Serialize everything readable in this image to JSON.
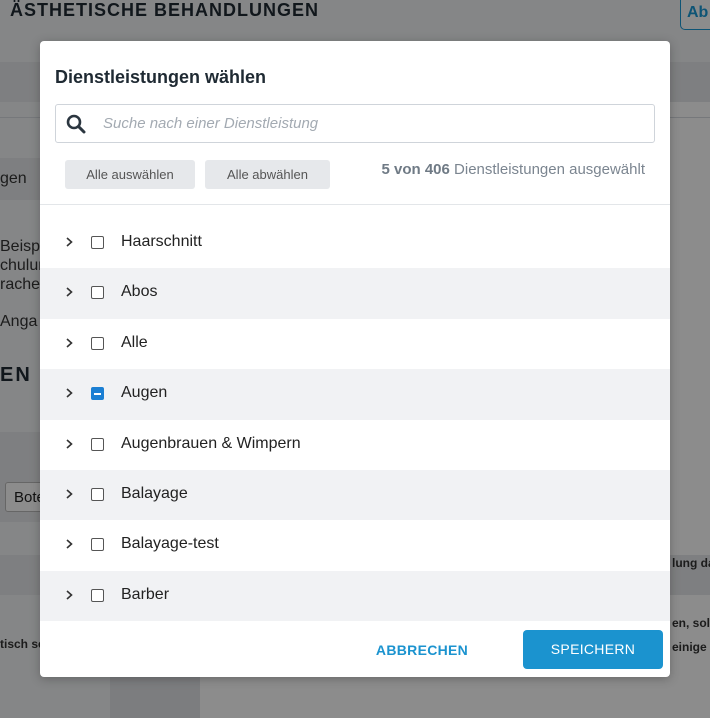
{
  "background": {
    "page_title": "ÄSTHETISCHE BEHANDLUNGEN",
    "header_button": "Ab",
    "fragments": [
      "gen",
      "Beisp",
      "chulun",
      "rache",
      "Anga",
      "EN",
      "Bote",
      "lung da",
      "en, sollt",
      "einige",
      "tisch se"
    ]
  },
  "modal": {
    "title": "Dienstleistungen wählen",
    "search_placeholder": "Suche nach einer Dienstleistung",
    "select_all": "Alle auswählen",
    "deselect_all": "Alle abwählen",
    "count_prefix": "5 von 406",
    "count_suffix": "Dienstleistungen ausgewählt",
    "items": [
      {
        "label": "Haarschnitt",
        "state": "unchecked"
      },
      {
        "label": "Abos",
        "state": "unchecked"
      },
      {
        "label": "Alle",
        "state": "unchecked"
      },
      {
        "label": "Augen",
        "state": "partial"
      },
      {
        "label": "Augenbrauen & Wimpern",
        "state": "unchecked"
      },
      {
        "label": "Balayage",
        "state": "unchecked"
      },
      {
        "label": "Balayage-test",
        "state": "unchecked"
      },
      {
        "label": "Barber",
        "state": "unchecked"
      }
    ],
    "cancel": "ABBRECHEN",
    "save": "SPEICHERN"
  },
  "colors": {
    "accent": "#1b93cf",
    "checkbox_partial": "#1b7fd3"
  }
}
